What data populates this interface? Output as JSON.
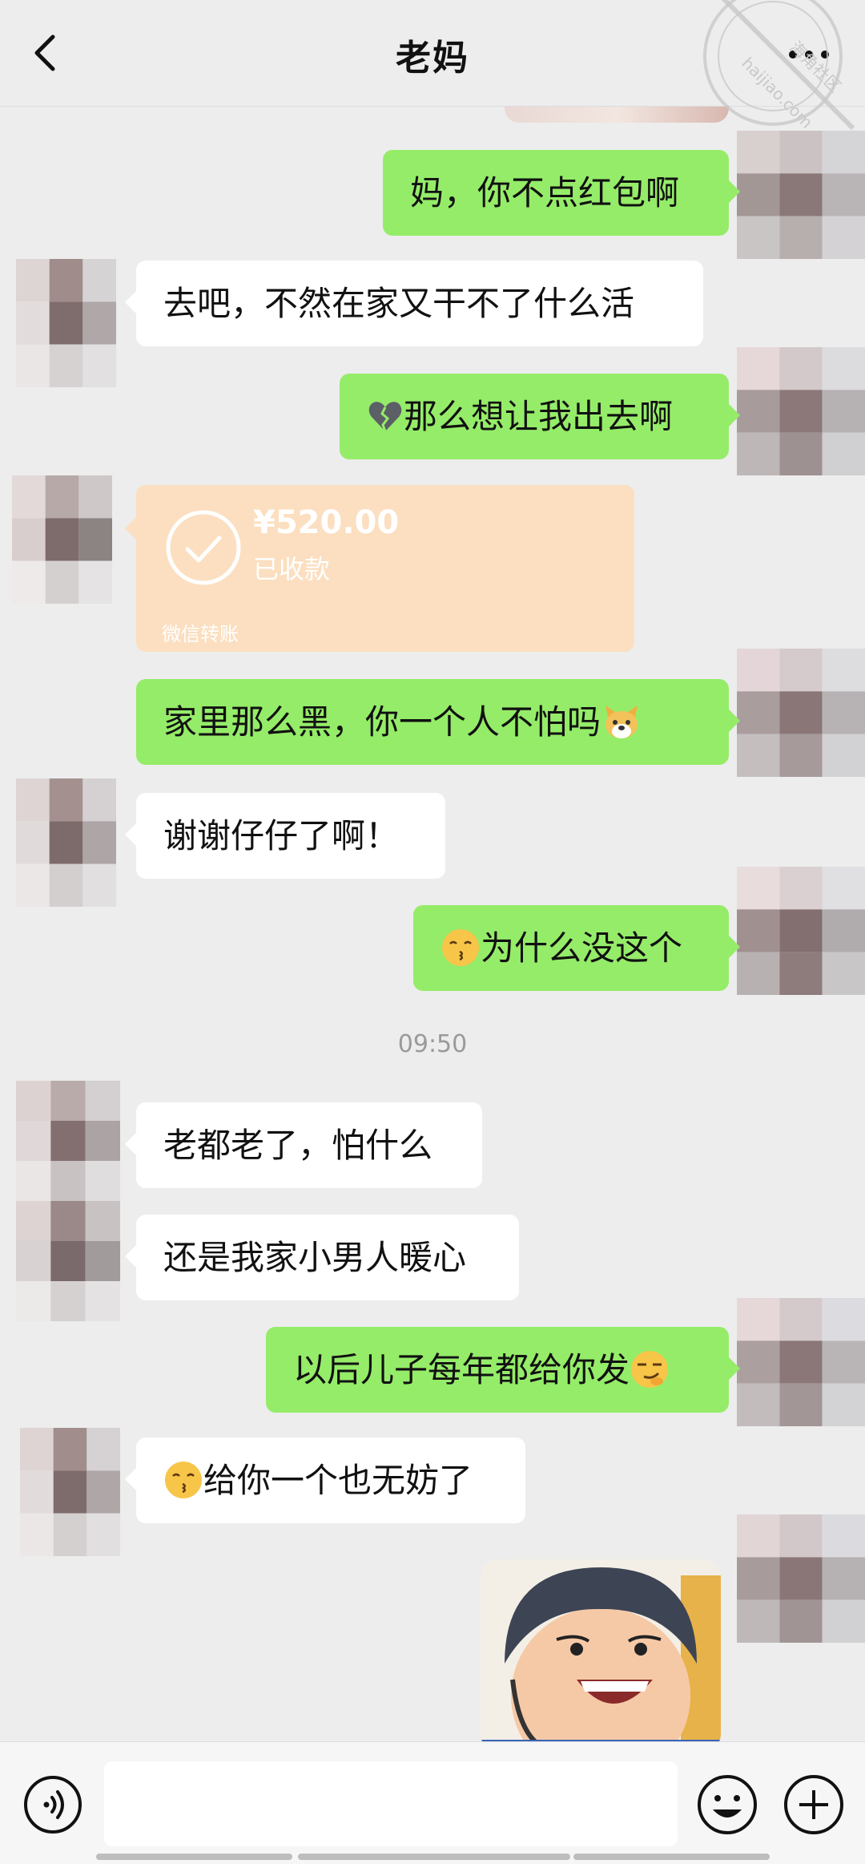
{
  "header": {
    "title": "老妈",
    "back_icon": "chevron-left-icon",
    "more_icon": "more-dots-icon"
  },
  "watermark": {
    "site_cn": "海角社区",
    "site_en": "haijiao.com"
  },
  "messages": [
    {
      "side": "out",
      "text": "妈，你不点红包啊"
    },
    {
      "side": "in",
      "text": "去吧，不然在家又干不了什么活"
    },
    {
      "side": "out",
      "emoji": "broken-heart",
      "text": "那么想让我出去啊"
    },
    {
      "side": "in",
      "type": "transfer",
      "amount": "¥520.00",
      "status": "已收款",
      "source": "微信转账"
    },
    {
      "side": "out",
      "text": "家里那么黑，你一个人不怕吗",
      "emoji": "dog-face"
    },
    {
      "side": "in",
      "text": "谢谢仔仔了啊！"
    },
    {
      "side": "out",
      "emoji": "kissing-face",
      "text": "为什么没这个"
    },
    {
      "side": "in",
      "text": "老都老了，怕什么"
    },
    {
      "side": "in",
      "text": "还是我家小男人暖心"
    },
    {
      "side": "out",
      "text": "以后儿子每年都给你发",
      "emoji": "smirk-face"
    },
    {
      "side": "in",
      "emoji": "kissing-face",
      "text": "给你一个也无妨了"
    },
    {
      "side": "out",
      "type": "image",
      "description": "sticker-photo-smiling-child"
    }
  ],
  "timestamp": "09:50",
  "transfer": {
    "amount": "¥520.00",
    "status": "已收款",
    "source": "微信转账",
    "color": "#fbdfc0"
  },
  "inputbar": {
    "voice_icon": "voice-icon",
    "emoji_icon": "emoji-icon",
    "plus_icon": "plus-icon",
    "input_value": ""
  },
  "colors": {
    "background": "#ededed",
    "outgoing_bubble": "#95ec69",
    "incoming_bubble": "#ffffff"
  }
}
